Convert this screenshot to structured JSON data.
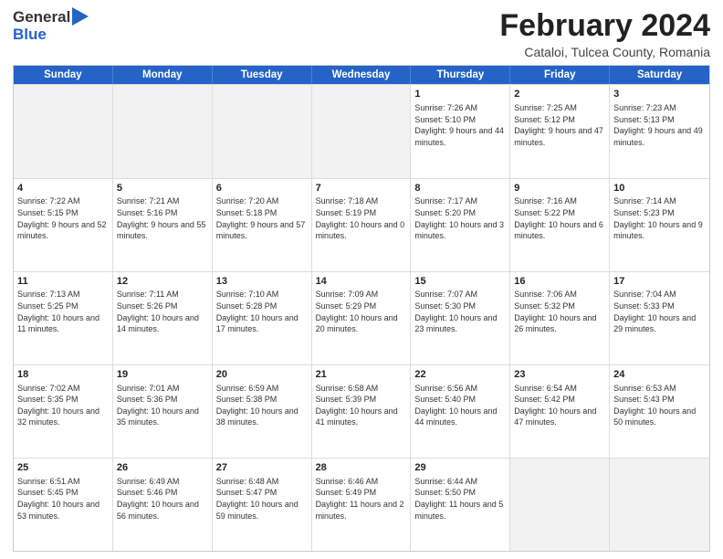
{
  "logo": {
    "general": "General",
    "blue": "Blue"
  },
  "title": {
    "main": "February 2024",
    "sub": "Cataloi, Tulcea County, Romania"
  },
  "header_days": [
    "Sunday",
    "Monday",
    "Tuesday",
    "Wednesday",
    "Thursday",
    "Friday",
    "Saturday"
  ],
  "weeks": [
    [
      {
        "day": "",
        "sunrise": "",
        "sunset": "",
        "daylight": "",
        "empty": true
      },
      {
        "day": "",
        "sunrise": "",
        "sunset": "",
        "daylight": "",
        "empty": true
      },
      {
        "day": "",
        "sunrise": "",
        "sunset": "",
        "daylight": "",
        "empty": true
      },
      {
        "day": "",
        "sunrise": "",
        "sunset": "",
        "daylight": "",
        "empty": true
      },
      {
        "day": "1",
        "sunrise": "Sunrise: 7:26 AM",
        "sunset": "Sunset: 5:10 PM",
        "daylight": "Daylight: 9 hours and 44 minutes."
      },
      {
        "day": "2",
        "sunrise": "Sunrise: 7:25 AM",
        "sunset": "Sunset: 5:12 PM",
        "daylight": "Daylight: 9 hours and 47 minutes."
      },
      {
        "day": "3",
        "sunrise": "Sunrise: 7:23 AM",
        "sunset": "Sunset: 5:13 PM",
        "daylight": "Daylight: 9 hours and 49 minutes."
      }
    ],
    [
      {
        "day": "4",
        "sunrise": "Sunrise: 7:22 AM",
        "sunset": "Sunset: 5:15 PM",
        "daylight": "Daylight: 9 hours and 52 minutes."
      },
      {
        "day": "5",
        "sunrise": "Sunrise: 7:21 AM",
        "sunset": "Sunset: 5:16 PM",
        "daylight": "Daylight: 9 hours and 55 minutes."
      },
      {
        "day": "6",
        "sunrise": "Sunrise: 7:20 AM",
        "sunset": "Sunset: 5:18 PM",
        "daylight": "Daylight: 9 hours and 57 minutes."
      },
      {
        "day": "7",
        "sunrise": "Sunrise: 7:18 AM",
        "sunset": "Sunset: 5:19 PM",
        "daylight": "Daylight: 10 hours and 0 minutes."
      },
      {
        "day": "8",
        "sunrise": "Sunrise: 7:17 AM",
        "sunset": "Sunset: 5:20 PM",
        "daylight": "Daylight: 10 hours and 3 minutes."
      },
      {
        "day": "9",
        "sunrise": "Sunrise: 7:16 AM",
        "sunset": "Sunset: 5:22 PM",
        "daylight": "Daylight: 10 hours and 6 minutes."
      },
      {
        "day": "10",
        "sunrise": "Sunrise: 7:14 AM",
        "sunset": "Sunset: 5:23 PM",
        "daylight": "Daylight: 10 hours and 9 minutes."
      }
    ],
    [
      {
        "day": "11",
        "sunrise": "Sunrise: 7:13 AM",
        "sunset": "Sunset: 5:25 PM",
        "daylight": "Daylight: 10 hours and 11 minutes."
      },
      {
        "day": "12",
        "sunrise": "Sunrise: 7:11 AM",
        "sunset": "Sunset: 5:26 PM",
        "daylight": "Daylight: 10 hours and 14 minutes."
      },
      {
        "day": "13",
        "sunrise": "Sunrise: 7:10 AM",
        "sunset": "Sunset: 5:28 PM",
        "daylight": "Daylight: 10 hours and 17 minutes."
      },
      {
        "day": "14",
        "sunrise": "Sunrise: 7:09 AM",
        "sunset": "Sunset: 5:29 PM",
        "daylight": "Daylight: 10 hours and 20 minutes."
      },
      {
        "day": "15",
        "sunrise": "Sunrise: 7:07 AM",
        "sunset": "Sunset: 5:30 PM",
        "daylight": "Daylight: 10 hours and 23 minutes."
      },
      {
        "day": "16",
        "sunrise": "Sunrise: 7:06 AM",
        "sunset": "Sunset: 5:32 PM",
        "daylight": "Daylight: 10 hours and 26 minutes."
      },
      {
        "day": "17",
        "sunrise": "Sunrise: 7:04 AM",
        "sunset": "Sunset: 5:33 PM",
        "daylight": "Daylight: 10 hours and 29 minutes."
      }
    ],
    [
      {
        "day": "18",
        "sunrise": "Sunrise: 7:02 AM",
        "sunset": "Sunset: 5:35 PM",
        "daylight": "Daylight: 10 hours and 32 minutes."
      },
      {
        "day": "19",
        "sunrise": "Sunrise: 7:01 AM",
        "sunset": "Sunset: 5:36 PM",
        "daylight": "Daylight: 10 hours and 35 minutes."
      },
      {
        "day": "20",
        "sunrise": "Sunrise: 6:59 AM",
        "sunset": "Sunset: 5:38 PM",
        "daylight": "Daylight: 10 hours and 38 minutes."
      },
      {
        "day": "21",
        "sunrise": "Sunrise: 6:58 AM",
        "sunset": "Sunset: 5:39 PM",
        "daylight": "Daylight: 10 hours and 41 minutes."
      },
      {
        "day": "22",
        "sunrise": "Sunrise: 6:56 AM",
        "sunset": "Sunset: 5:40 PM",
        "daylight": "Daylight: 10 hours and 44 minutes."
      },
      {
        "day": "23",
        "sunrise": "Sunrise: 6:54 AM",
        "sunset": "Sunset: 5:42 PM",
        "daylight": "Daylight: 10 hours and 47 minutes."
      },
      {
        "day": "24",
        "sunrise": "Sunrise: 6:53 AM",
        "sunset": "Sunset: 5:43 PM",
        "daylight": "Daylight: 10 hours and 50 minutes."
      }
    ],
    [
      {
        "day": "25",
        "sunrise": "Sunrise: 6:51 AM",
        "sunset": "Sunset: 5:45 PM",
        "daylight": "Daylight: 10 hours and 53 minutes."
      },
      {
        "day": "26",
        "sunrise": "Sunrise: 6:49 AM",
        "sunset": "Sunset: 5:46 PM",
        "daylight": "Daylight: 10 hours and 56 minutes."
      },
      {
        "day": "27",
        "sunrise": "Sunrise: 6:48 AM",
        "sunset": "Sunset: 5:47 PM",
        "daylight": "Daylight: 10 hours and 59 minutes."
      },
      {
        "day": "28",
        "sunrise": "Sunrise: 6:46 AM",
        "sunset": "Sunset: 5:49 PM",
        "daylight": "Daylight: 11 hours and 2 minutes."
      },
      {
        "day": "29",
        "sunrise": "Sunrise: 6:44 AM",
        "sunset": "Sunset: 5:50 PM",
        "daylight": "Daylight: 11 hours and 5 minutes."
      },
      {
        "day": "",
        "sunrise": "",
        "sunset": "",
        "daylight": "",
        "empty": true
      },
      {
        "day": "",
        "sunrise": "",
        "sunset": "",
        "daylight": "",
        "empty": true
      }
    ]
  ]
}
